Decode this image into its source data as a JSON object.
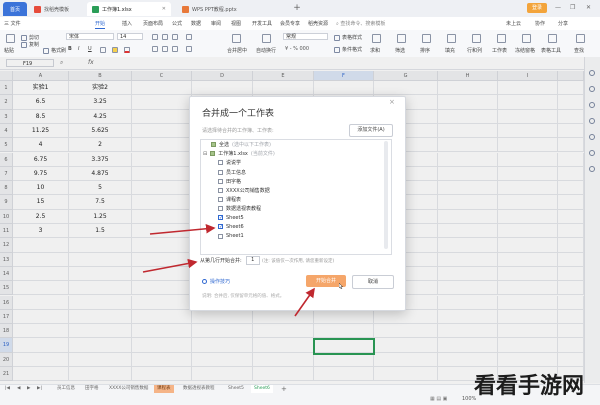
{
  "window": {
    "home_tab": "首页",
    "tabs": [
      {
        "label": "找稻壳模板",
        "color": "#e64b3b"
      },
      {
        "label": "工作簿1.xlsx",
        "color": "#2b9e58"
      },
      {
        "label": "WPS PPT教程.pptx",
        "color": "#e8793a"
      }
    ],
    "new_tab": "+",
    "login_label": "登录",
    "controls": [
      "—",
      "❐",
      "✕"
    ]
  },
  "menu": {
    "file": "三 文件",
    "items": [
      "开始",
      "插入",
      "页面布局",
      "公式",
      "数据",
      "审阅",
      "视图",
      "开发工具",
      "会员专享",
      "稻壳资源"
    ],
    "active_index": 0,
    "search": "查找命令、搜索模板",
    "right": [
      "未上云",
      "协作",
      "分享"
    ]
  },
  "toolbar": {
    "paste": "粘贴",
    "cut": "剪切",
    "copy": "复制",
    "format_painter": "格式刷",
    "font_name": "宋体",
    "font_size": "14",
    "merge": "合并居中",
    "wrap": "自动换行",
    "number_format": "常规",
    "cond_format": "条件格式",
    "table_style": "表格样式",
    "cell_style": "单元格样式",
    "sum": "求和",
    "filter": "筛选",
    "sort": "排序",
    "fill": "填充",
    "rowcol": "行和列",
    "worksheet": "工作表",
    "freeze": "冻结窗格",
    "table_tools": "表格工具",
    "find": "查找"
  },
  "formula_bar": {
    "cell_ref": "F19",
    "fx": "fx",
    "value": ""
  },
  "grid": {
    "columns": [
      "A",
      "B",
      "C",
      "D",
      "E",
      "F",
      "G",
      "H",
      "I"
    ],
    "selected_column": "F",
    "selected_row": "19",
    "rows": [
      {
        "n": "1",
        "a": "实验1",
        "b": "实验2"
      },
      {
        "n": "2",
        "a": "6.5",
        "b": "3.25"
      },
      {
        "n": "3",
        "a": "8.5",
        "b": "4.25"
      },
      {
        "n": "4",
        "a": "11.25",
        "b": "5.625"
      },
      {
        "n": "5",
        "a": "4",
        "b": "2"
      },
      {
        "n": "6",
        "a": "6.75",
        "b": "3.375"
      },
      {
        "n": "7",
        "a": "9.75",
        "b": "4.875"
      },
      {
        "n": "8",
        "a": "10",
        "b": "5"
      },
      {
        "n": "9",
        "a": "15",
        "b": "7.5"
      },
      {
        "n": "10",
        "a": "2.5",
        "b": "1.25"
      },
      {
        "n": "11",
        "a": "3",
        "b": "1.5"
      },
      {
        "n": "12",
        "a": "",
        "b": ""
      },
      {
        "n": "13",
        "a": "",
        "b": ""
      },
      {
        "n": "14",
        "a": "",
        "b": ""
      },
      {
        "n": "15",
        "a": "",
        "b": ""
      },
      {
        "n": "16",
        "a": "",
        "b": ""
      },
      {
        "n": "17",
        "a": "",
        "b": ""
      },
      {
        "n": "18",
        "a": "",
        "b": ""
      },
      {
        "n": "19",
        "a": "",
        "b": ""
      },
      {
        "n": "20",
        "a": "",
        "b": ""
      },
      {
        "n": "21",
        "a": "",
        "b": ""
      }
    ]
  },
  "dialog": {
    "title": "合并成一个工作表",
    "close": "×",
    "hint": "请选择待合并的工作簿、工作表:",
    "add_file": "添加文件(A)",
    "items": [
      {
        "label": "全选",
        "note": "(选中以下工作表)",
        "state": "half",
        "indent": 0
      },
      {
        "label": "工作簿1.xlsx",
        "note": "(当前文件)",
        "state": "half",
        "indent": 0,
        "expander": "⊟"
      },
      {
        "label": "说说学",
        "state": "off",
        "indent": 1
      },
      {
        "label": "员工信息",
        "state": "off",
        "indent": 1
      },
      {
        "label": "田字格",
        "state": "off",
        "indent": 1
      },
      {
        "label": "XXXX公司销售数据",
        "state": "off",
        "indent": 1
      },
      {
        "label": "课程表",
        "state": "off",
        "indent": 1
      },
      {
        "label": "数据透视表教程",
        "state": "off",
        "indent": 1
      },
      {
        "label": "Sheet5",
        "state": "on",
        "indent": 1
      },
      {
        "label": "Sheet6",
        "state": "on",
        "indent": 1
      },
      {
        "label": "Sheet1",
        "state": "off",
        "indent": 1
      }
    ],
    "start_row_label": "从第几行开始合并:",
    "start_row_value": "1",
    "start_row_hint": "(注: 该值仅一次作用, 请您重新设定)",
    "advanced": "操作技巧",
    "ok": "开始合并",
    "cancel": "取消",
    "description": "说明: 合并后, 仅保留单元格的值、格式。"
  },
  "sheets": {
    "nav": [
      "|◀",
      "◀",
      "▶",
      "▶|"
    ],
    "tabs": [
      {
        "label": "员工信息",
        "style": "normal"
      },
      {
        "label": "田字格",
        "style": "normal"
      },
      {
        "label": "XXXX公司销售数据",
        "style": "normal"
      },
      {
        "label": "课程表",
        "style": "hl"
      },
      {
        "label": "数据透视表教程",
        "style": "normal"
      },
      {
        "label": "Sheet5",
        "style": "normal"
      },
      {
        "label": "Sheet6",
        "style": "active"
      }
    ],
    "add": "+"
  },
  "status": {
    "zoom": "100%"
  },
  "watermark": "看看手游网",
  "colors": {
    "accent": "#2f68d1",
    "excel_green": "#2b9e58",
    "ok_button": "#f5a66a",
    "arrow": "#c0282f"
  }
}
